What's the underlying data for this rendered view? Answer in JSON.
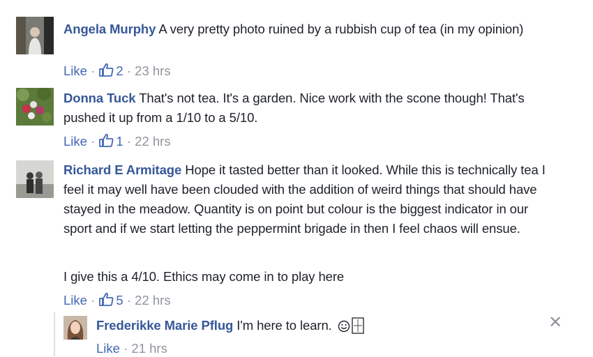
{
  "comments": [
    {
      "author": "Angela Murphy",
      "text": " A very pretty photo ruined by a rubbish cup of tea (in my opinion)",
      "like_label": "Like",
      "sep1": " · ",
      "likes": "2",
      "sep2": " · ",
      "time": "23 hrs"
    },
    {
      "author": "Donna Tuck",
      "text": " That's not tea. It's a garden. Nice work with the scone though! That's pushed it up from a 1/10 to a 5/10.",
      "like_label": "Like",
      "sep1": " · ",
      "likes": "1",
      "sep2": " · ",
      "time": "22 hrs"
    },
    {
      "author": "Richard E Armitage",
      "text": " Hope it tasted better than it looked. While this is technically tea I feel it may well have been clouded with the addition of weird things that should have stayed in the meadow. Quantity is on point but colour is the biggest indicator in our sport and if we start letting the peppermint brigade in then I feel chaos will ensue.",
      "text2": "I give this a 4/10. Ethics may come in to play here",
      "like_label": "Like",
      "sep1": " · ",
      "likes": "5",
      "sep2": " · ",
      "time": "22 hrs"
    }
  ],
  "reply": {
    "author": "Frederikke Marie Pflug",
    "text": " I'm here to learn.",
    "like_label": "Like",
    "sep": " · ",
    "time": "21 hrs",
    "close_glyph": "✕"
  },
  "colors": {
    "author": "#365899",
    "link": "#4267b2",
    "meta": "#90949c",
    "text": "#1d2129"
  }
}
